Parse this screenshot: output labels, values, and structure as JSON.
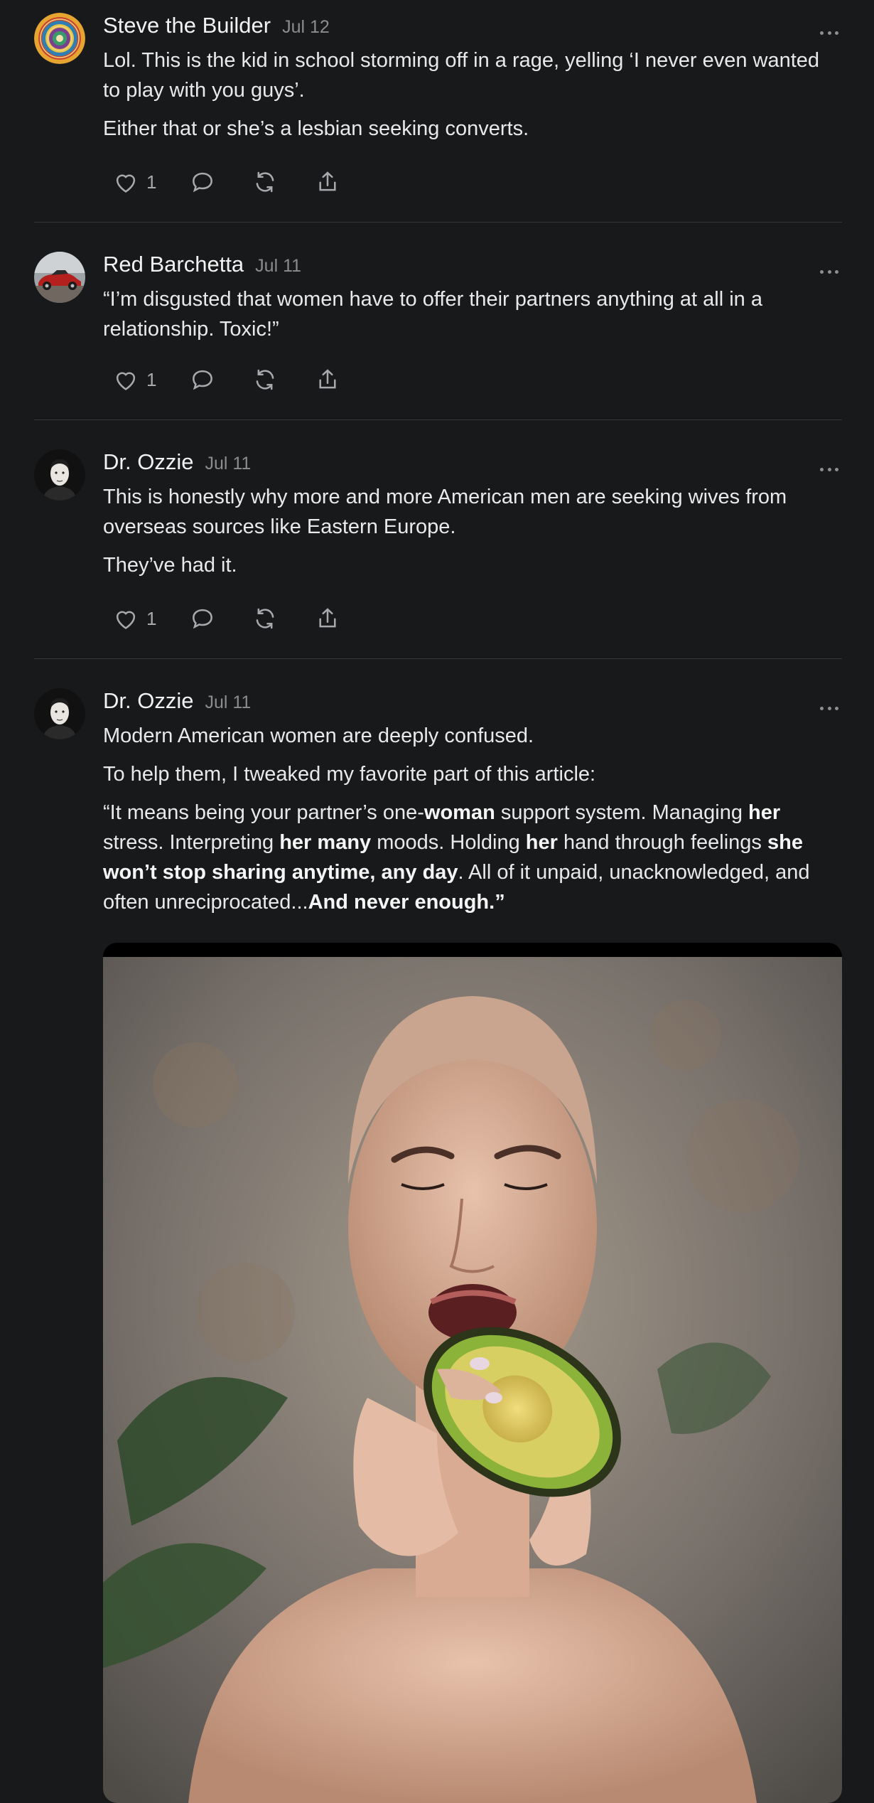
{
  "posts": [
    {
      "author": "Steve the Builder",
      "date": "Jul 12",
      "paragraphs": [
        "Lol. This is the kid in school storming off in a rage, yelling ‘I never even wanted to play with you guys’.",
        "Either that or she’s a lesbian seeking converts."
      ],
      "likes": "1"
    },
    {
      "author": "Red Barchetta",
      "date": "Jul 11",
      "paragraphs": [
        "“I’m disgusted that women have to offer their partners anything at all in a relationship. Toxic!”"
      ],
      "likes": "1"
    },
    {
      "author": "Dr. Ozzie",
      "date": "Jul 11",
      "paragraphs": [
        "This is honestly why more and more American men are seeking wives from overseas sources like Eastern Europe.",
        "They’ve had it."
      ],
      "likes": "1"
    },
    {
      "author": "Dr. Ozzie",
      "date": "Jul 11",
      "paragraphs": [
        "Modern American women are deeply confused.",
        "To help them, I tweaked my favorite part of this article:"
      ],
      "quote_segments": [
        {
          "t": "“It means being your partner’s one-",
          "b": false
        },
        {
          "t": "woman",
          "b": true
        },
        {
          "t": " support system. Managing ",
          "b": false
        },
        {
          "t": "her",
          "b": true
        },
        {
          "t": " stress. Interpreting ",
          "b": false
        },
        {
          "t": "her many",
          "b": true
        },
        {
          "t": " moods. Holding ",
          "b": false
        },
        {
          "t": "her",
          "b": true
        },
        {
          "t": " hand through feelings ",
          "b": false
        },
        {
          "t": "she won’t stop sharing anytime, any day",
          "b": true
        },
        {
          "t": ". All of it unpaid, unacknowledged, and often unreciprocated...",
          "b": false
        },
        {
          "t": "And never enough.”",
          "b": true
        }
      ],
      "image_icon": "photo-woman-eating-avocado"
    }
  ],
  "icons": {
    "like": "heart-icon",
    "comment": "comment-icon",
    "restack": "restack-icon",
    "share": "share-icon",
    "more": "more-options-icon"
  },
  "colors": {
    "background": "#18191b",
    "text": "#e9e9ea",
    "muted": "#8c8c8f",
    "divider": "#34353a"
  }
}
